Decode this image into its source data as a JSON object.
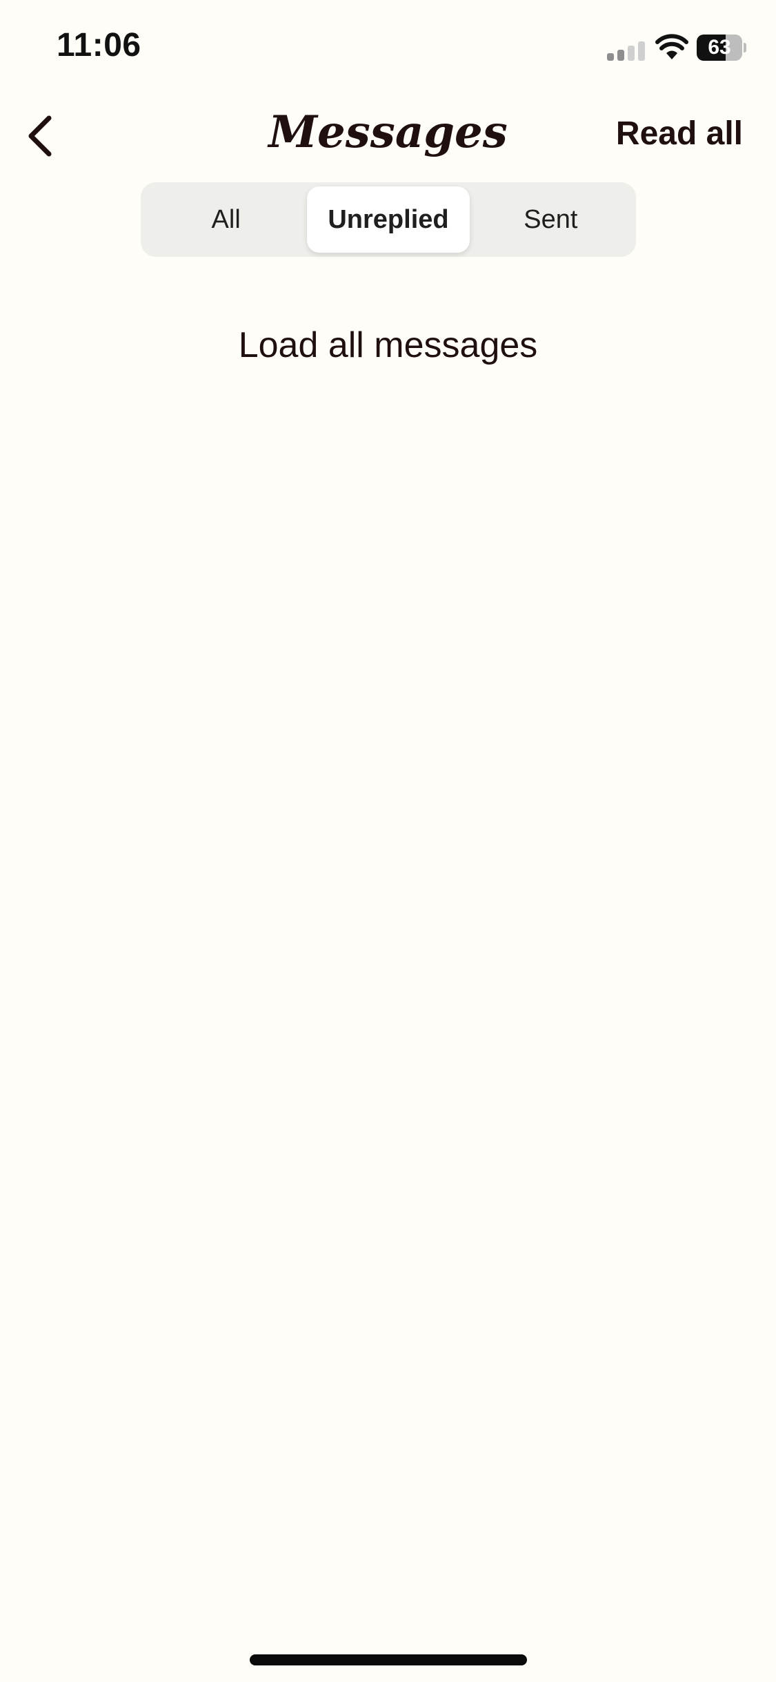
{
  "status_bar": {
    "time": "11:06",
    "battery_percent": 63,
    "battery_label": "63",
    "signal_bars_active": 2,
    "signal_bars_total": 4
  },
  "header": {
    "title": "Messages",
    "read_all_label": "Read all"
  },
  "tabs": {
    "items": [
      {
        "label": "All",
        "selected": false
      },
      {
        "label": "Unreplied",
        "selected": true
      },
      {
        "label": "Sent",
        "selected": false
      }
    ]
  },
  "content": {
    "load_all_label": "Load all messages"
  },
  "icons": {
    "back": "chevron-left-icon",
    "signal": "cellular-signal-icon",
    "wifi": "wifi-icon",
    "battery": "battery-icon"
  },
  "colors": {
    "background": "#fefdf8",
    "text_primary": "#1f0f0f",
    "segment_track": "#eeeeea",
    "segment_active": "#ffffff",
    "home_indicator": "#0a0a0a"
  }
}
